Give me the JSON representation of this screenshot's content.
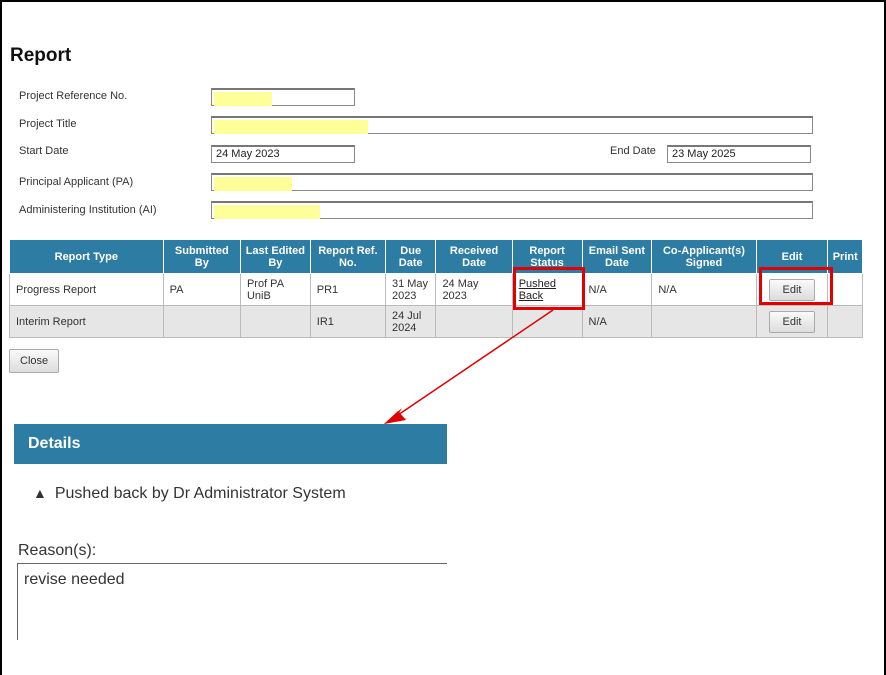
{
  "page": {
    "title": "Report"
  },
  "form": {
    "project_ref": {
      "label": "Project Reference No.",
      "value": ""
    },
    "project_title": {
      "label": "Project Title",
      "value": ""
    },
    "start_date": {
      "label": "Start Date",
      "value": "24 May 2023"
    },
    "end_date": {
      "label": "End Date",
      "value": "23 May 2025"
    },
    "principal_applicant": {
      "label": "Principal Applicant (PA)",
      "value": ""
    },
    "administering_institution": {
      "label": "Administering Institution (AI)",
      "value": ""
    }
  },
  "table": {
    "headers": [
      "Report Type",
      "Submitted By",
      "Last Edited By",
      "Report Ref. No.",
      "Due Date",
      "Received Date",
      "Report Status",
      "Email Sent Date",
      "Co-Applicant(s) Signed",
      "Edit",
      "Print"
    ],
    "rows": [
      {
        "report_type": "Progress Report",
        "submitted_by": "PA",
        "last_edited_by": "Prof PA UniB",
        "ref_no": "PR1",
        "due_date": "31 May 2023",
        "received_date": "24 May 2023",
        "status": "Pushed Back",
        "email_sent": "N/A",
        "co_signed": "N/A",
        "edit_label": "Edit"
      },
      {
        "report_type": "Interim Report",
        "submitted_by": "",
        "last_edited_by": "",
        "ref_no": "IR1",
        "due_date": "24 Jul 2024",
        "received_date": "",
        "status": "",
        "email_sent": "N/A",
        "co_signed": "",
        "edit_label": "Edit"
      }
    ]
  },
  "close_label": "Close",
  "details": {
    "title": "Details",
    "icon": "warning-icon",
    "pushed_message": "Pushed back by Dr Administrator System",
    "reason_label": "Reason(s):",
    "reason_text": "revise needed"
  },
  "colors": {
    "header_blue": "#2d7ca3",
    "highlight_yellow": "#ffff99",
    "annotation_red": "#e00000"
  }
}
